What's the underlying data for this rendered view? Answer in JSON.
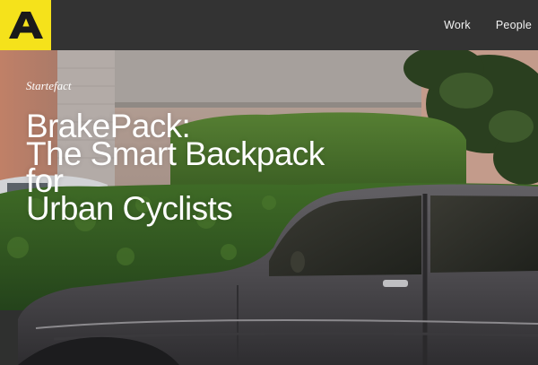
{
  "header": {
    "logo_icon": "letter-a-logo",
    "logo_color": "#f5e21b",
    "nav_items": [
      {
        "label": "Work"
      },
      {
        "label": "People"
      }
    ]
  },
  "hero": {
    "eyebrow": "Startefact",
    "headline_lines": [
      "BrakePack:",
      "The Smart Backpack",
      "for",
      "Urban Cyclists"
    ],
    "image_icon": "vintage-car-photo"
  }
}
